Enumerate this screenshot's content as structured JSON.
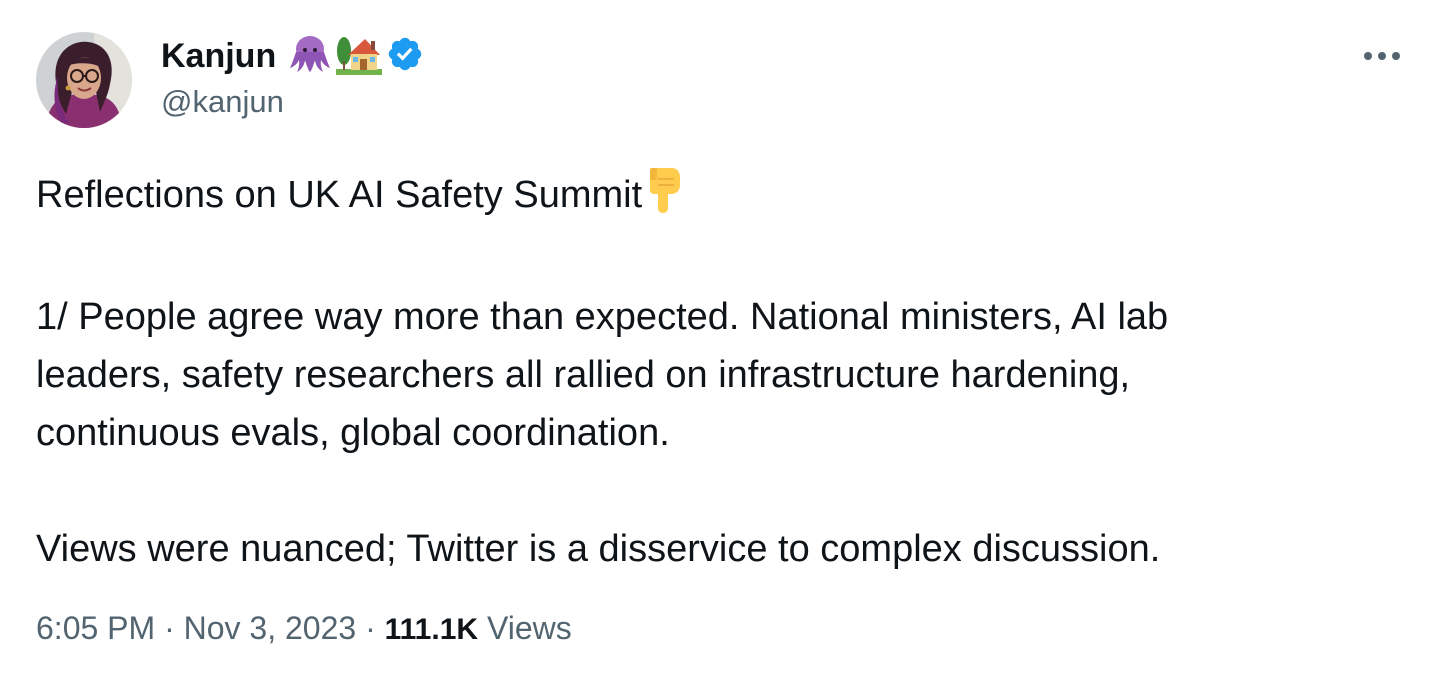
{
  "author": {
    "display_name": "Kanjun",
    "handle": "@kanjun",
    "name_icons": [
      "octopus-icon",
      "house-icon",
      "verified-badge-icon"
    ]
  },
  "tweet": {
    "lines": [
      "Reflections on UK AI Safety Summit",
      "1/ People agree way more than expected. National ministers, AI lab leaders, safety researchers all rallied on infrastructure hardening, continuous evals, global coordination.",
      "Views were nuanced; Twitter is a disservice to complex discussion."
    ],
    "title_emoji": "point-down-icon"
  },
  "meta": {
    "time": "6:05 PM",
    "separator": "·",
    "date": "Nov 3, 2023",
    "views_count": "111.1K",
    "views_label": "Views"
  },
  "colors": {
    "text_primary": "#0f1419",
    "text_secondary": "#536471",
    "verified_blue": "#1d9bf0"
  }
}
